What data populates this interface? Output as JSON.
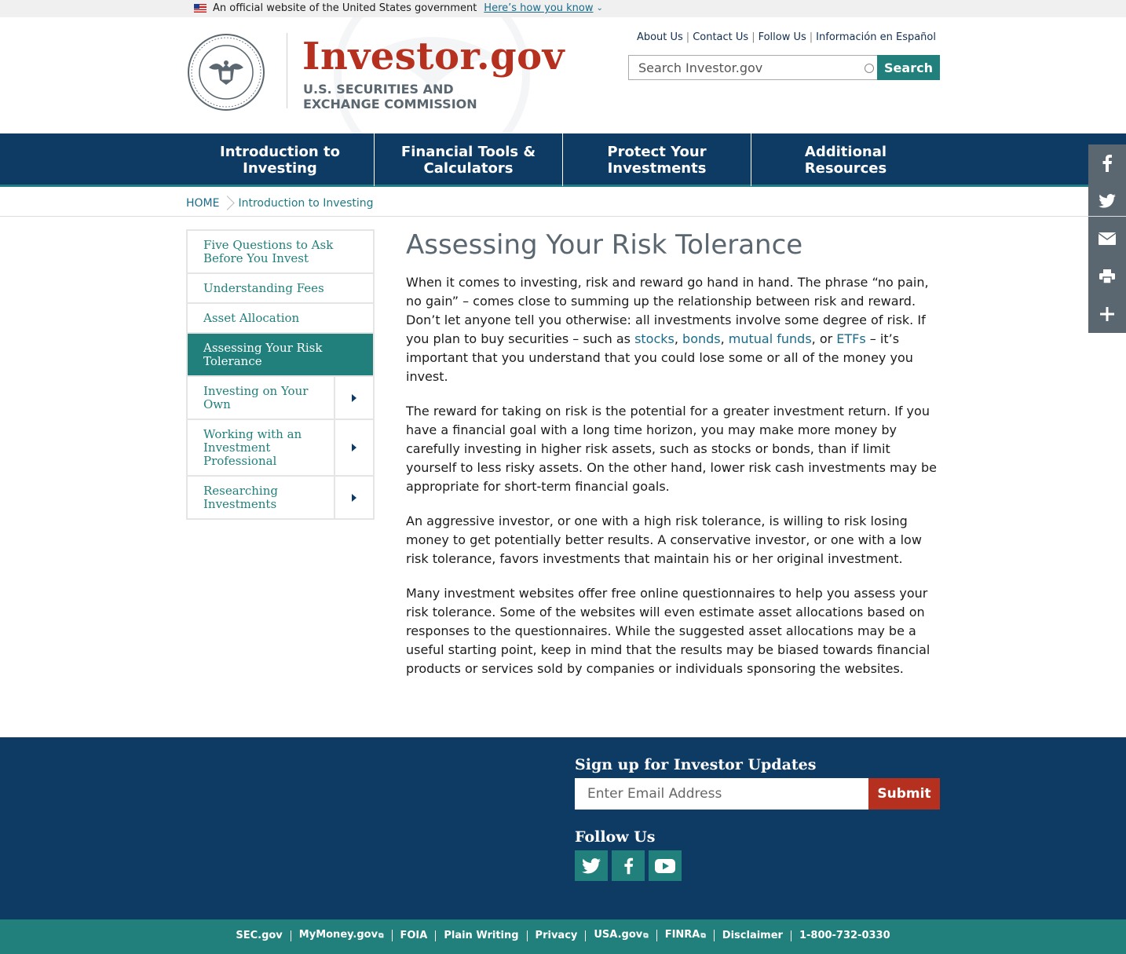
{
  "gov_banner": {
    "text": "An official website of the United States government",
    "link": "Here’s how you know"
  },
  "header": {
    "site_title": "Investor.gov",
    "agency_line1": "U.S. SECURITIES AND",
    "agency_line2": "EXCHANGE COMMISSION",
    "utility_links": [
      "About Us",
      "Contact Us",
      "Follow Us",
      "Información en Español"
    ],
    "search_placeholder": "Search Investor.gov",
    "search_button": "Search"
  },
  "nav": {
    "items": [
      {
        "label": "Introduction to Investing"
      },
      {
        "label": "Financial Tools & Calculators"
      },
      {
        "label": "Protect Your Investments"
      },
      {
        "label": "Additional Resources"
      }
    ]
  },
  "share_bar": {
    "icons": [
      "facebook-icon",
      "twitter-icon",
      "email-icon",
      "print-icon",
      "more-icon"
    ]
  },
  "breadcrumb": {
    "home": "HOME",
    "current": "Introduction to Investing"
  },
  "sidebar": {
    "items": [
      {
        "label": "Five Questions to Ask Before You Invest",
        "active": false,
        "expandable": false
      },
      {
        "label": "Understanding Fees",
        "active": false,
        "expandable": false
      },
      {
        "label": "Asset Allocation",
        "active": false,
        "expandable": false
      },
      {
        "label": "Assessing Your Risk Tolerance",
        "active": true,
        "expandable": false
      },
      {
        "label": "Investing on Your Own",
        "active": false,
        "expandable": true
      },
      {
        "label": "Working with an Investment Professional",
        "active": false,
        "expandable": true
      },
      {
        "label": "Researching Investments",
        "active": false,
        "expandable": true
      }
    ]
  },
  "main": {
    "title": "Assessing Your Risk Tolerance",
    "p1_a": "When it comes to investing, risk and reward go hand in hand. The phrase “no pain, no gain” – comes close to summing up the relationship between risk and reward. Don’t let anyone tell you otherwise: all investments involve some degree of risk. If you plan to buy securities – such as ",
    "link_stocks": "stocks",
    "link_bonds": "bonds",
    "link_mutual_funds": "mutual funds",
    "link_etfs": "ETFs",
    "sep_comma": ", ",
    "sep_or": ", or ",
    "p1_b": " – it’s important that you understand that you could lose some or all of the money you invest.",
    "p2": "The reward for taking on risk is the potential for a greater investment return. If you have a financial goal with a long time horizon, you may make more money by carefully investing in higher risk assets, such as stocks or bonds, than if limit yourself to less risky assets. On the other hand, lower risk cash investments may be appropriate for short-term financial goals.",
    "p3": "An aggressive investor, or one with a high risk tolerance, is willing to risk losing money to get potentially better results. A conservative investor, or one with a low risk tolerance, favors investments that maintain his or her original investment.",
    "p4": "Many investment websites offer free online questionnaires to help you assess your risk tolerance. Some of the websites will even estimate asset allocations based on responses to the questionnaires. While the suggested asset allocations may be a useful starting point, keep in mind that the results may be biased towards financial products or services sold by companies or individuals sponsoring the websites."
  },
  "footer": {
    "signup_title": "Sign up for Investor Updates",
    "email_placeholder": "Enter Email Address",
    "submit": "Submit",
    "follow_title": "Follow Us",
    "bottom_links": [
      "SEC.gov",
      "MyMoney.gov",
      "FOIA",
      "Plain Writing",
      "Privacy",
      "USA.gov",
      "FINRA",
      "Disclaimer",
      "1-800-732-0330"
    ]
  },
  "colors": {
    "navy": "#0d3b63",
    "teal": "#21807b",
    "brand_red": "#b5301f",
    "slate": "#5b6770"
  }
}
